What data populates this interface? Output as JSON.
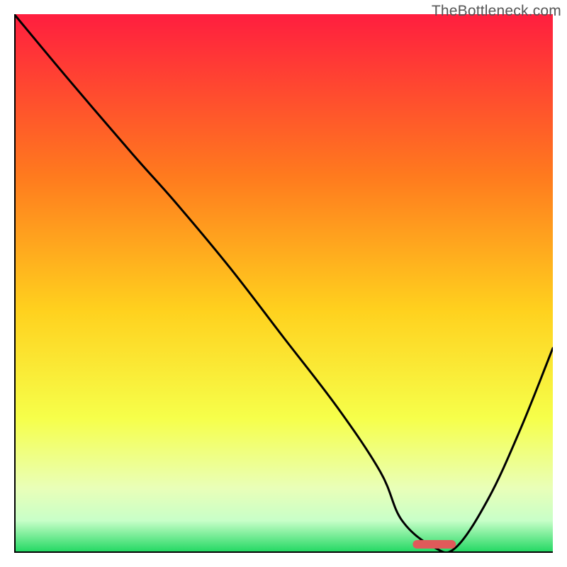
{
  "watermark": "TheBottleneck.com",
  "chart_data": {
    "type": "line",
    "title": "",
    "xlabel": "",
    "ylabel": "",
    "xlim": [
      0,
      100
    ],
    "ylim": [
      0,
      100
    ],
    "grid": false,
    "legend": false,
    "gradient_stops": [
      {
        "offset": 0.0,
        "color": "#ff1e3f"
      },
      {
        "offset": 0.3,
        "color": "#ff7a1e"
      },
      {
        "offset": 0.55,
        "color": "#ffd11e"
      },
      {
        "offset": 0.75,
        "color": "#f6ff4a"
      },
      {
        "offset": 0.88,
        "color": "#e9ffb8"
      },
      {
        "offset": 0.94,
        "color": "#c8ffc8"
      },
      {
        "offset": 1.0,
        "color": "#1ed760"
      }
    ],
    "series": [
      {
        "name": "bottleneck-curve",
        "x": [
          0,
          10,
          22,
          30,
          40,
          50,
          60,
          68,
          72,
          78,
          82,
          88,
          94,
          100
        ],
        "y": [
          100,
          88,
          74,
          65,
          53,
          40,
          27,
          15,
          6,
          1,
          1,
          10,
          23,
          38
        ]
      }
    ],
    "marker": {
      "name": "current-config",
      "x_start": 74,
      "x_end": 82,
      "color": "#e05a5a"
    }
  }
}
